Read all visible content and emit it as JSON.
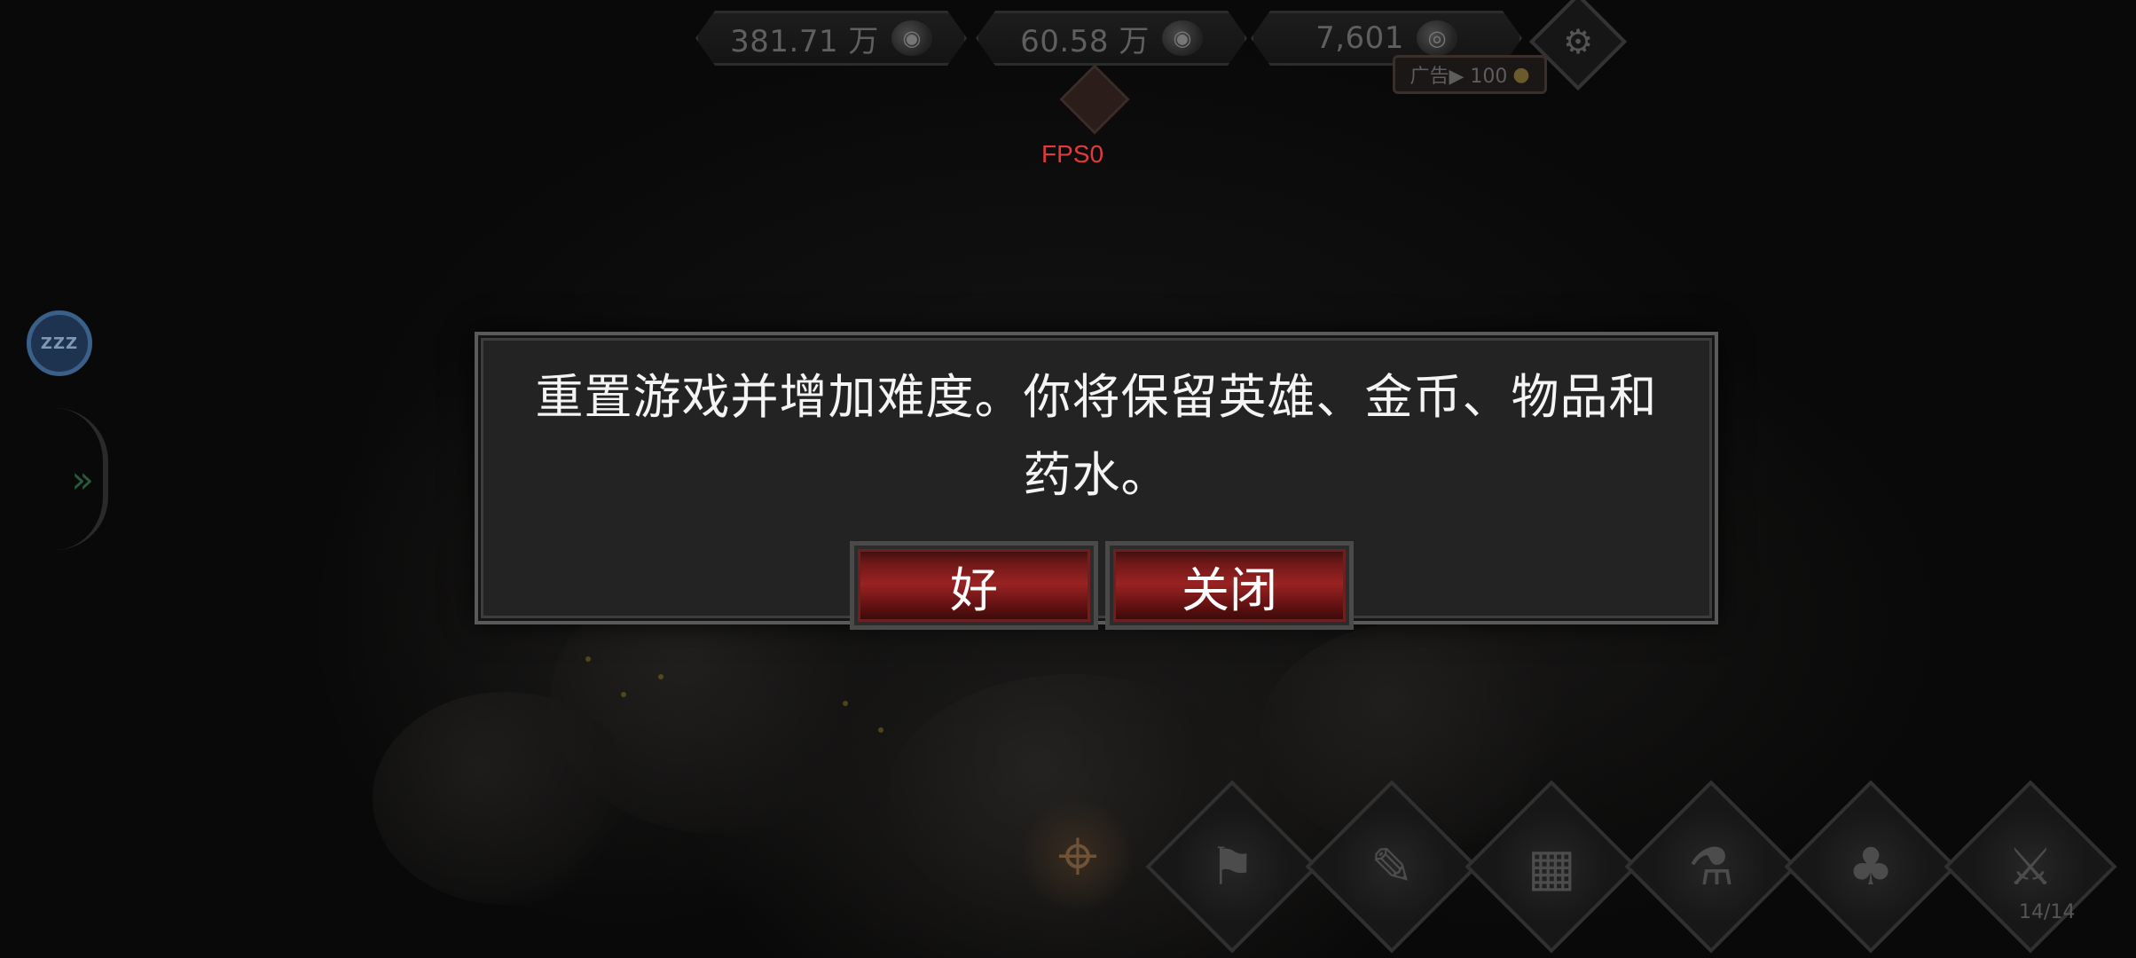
{
  "currencies": [
    {
      "value": "381.71 万",
      "icon": "gold-pile-icon"
    },
    {
      "value": "60.58 万",
      "icon": "silver-pile-icon"
    },
    {
      "value": "7,601",
      "icon": "coin-stack-icon"
    }
  ],
  "ad_reward": {
    "label": "广告▶ 100",
    "icon": "coin-icon"
  },
  "fps_label": "FPS0",
  "dialog": {
    "message": "重置游戏并增加难度。你将保留英雄、金币、物品和药水。",
    "ok_label": "好",
    "close_label": "关闭"
  },
  "sleep_button": {
    "label": "ZZZ"
  },
  "actions": [
    {
      "icon": "treasure-map-icon"
    },
    {
      "icon": "flag-icon"
    },
    {
      "icon": "scroll-quest-icon"
    },
    {
      "icon": "resources-icon"
    },
    {
      "icon": "potion-icon"
    },
    {
      "icon": "loot-bag-icon"
    },
    {
      "icon": "crossed-swords-icon",
      "counter": "14/14"
    }
  ],
  "colors": {
    "fps": "#e23a3a",
    "button_red": "#9a2222",
    "sleep_blue": "#3a5f88"
  }
}
